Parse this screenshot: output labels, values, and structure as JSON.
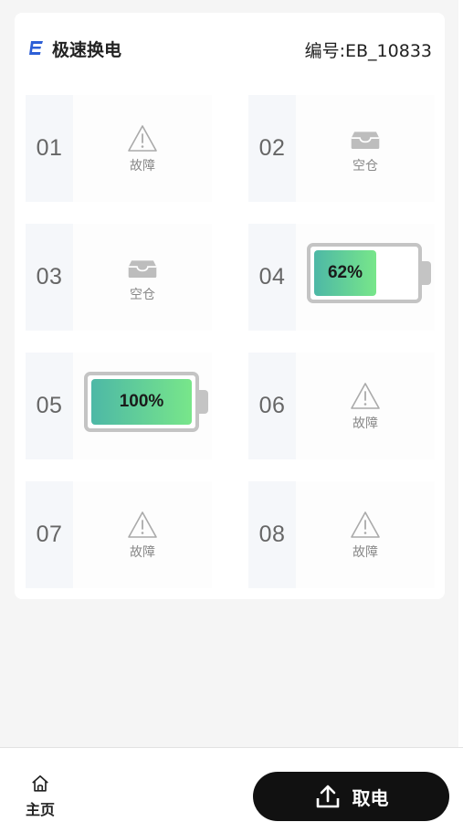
{
  "header": {
    "title": "极速换电",
    "code": "编号:EB_10833",
    "logo_icon": "station-logo-icon",
    "brand_color": "#2d5fd6"
  },
  "slots": [
    {
      "number": "01",
      "status": "fault",
      "label": "故障",
      "icon": "warning-triangle-icon"
    },
    {
      "number": "02",
      "status": "empty",
      "label": "空仓",
      "icon": "empty-tray-icon"
    },
    {
      "number": "03",
      "status": "empty",
      "label": "空仓",
      "icon": "empty-tray-icon"
    },
    {
      "number": "04",
      "status": "battery",
      "percent_label": "62%",
      "percent": 62,
      "icon": "battery-icon"
    },
    {
      "number": "05",
      "status": "battery",
      "percent_label": "100%",
      "percent": 100,
      "icon": "battery-icon"
    },
    {
      "number": "06",
      "status": "fault",
      "label": "故障",
      "icon": "warning-triangle-icon"
    },
    {
      "number": "07",
      "status": "fault",
      "label": "故障",
      "icon": "warning-triangle-icon"
    },
    {
      "number": "08",
      "status": "fault",
      "label": "故障",
      "icon": "warning-triangle-icon"
    }
  ],
  "bottom_nav": {
    "home_label": "主页",
    "home_icon": "home-icon",
    "take_button_label": "取电",
    "take_button_icon": "upload-icon"
  },
  "colors": {
    "battery_gradient_start": "#4db8a6",
    "battery_gradient_end": "#78e68a",
    "button_bg": "#111111"
  }
}
